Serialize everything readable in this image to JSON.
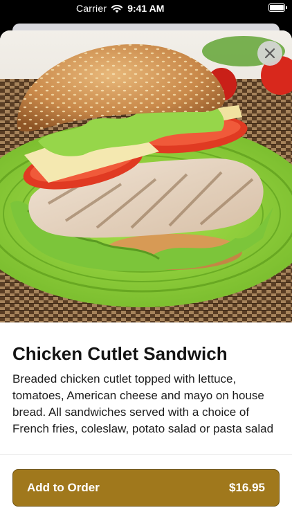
{
  "status_bar": {
    "carrier": "Carrier",
    "time": "9:41 AM"
  },
  "item": {
    "image_alt": "Chicken cutlet sandwich on a green plate",
    "title": "Chicken Cutlet Sandwich",
    "description": "Breaded chicken cutlet topped with lettuce, tomatoes, American cheese and mayo on house bread. All sandwiches served with a choice of French fries, coleslaw, potato salad or pasta salad"
  },
  "footer": {
    "button_label": "Add to Order",
    "price": "$16.95"
  },
  "colors": {
    "accent": "#a0781c",
    "plate": "#8fd13a",
    "background": "#ffffff"
  },
  "icons": [
    "wifi-icon",
    "battery-icon",
    "close-icon"
  ]
}
